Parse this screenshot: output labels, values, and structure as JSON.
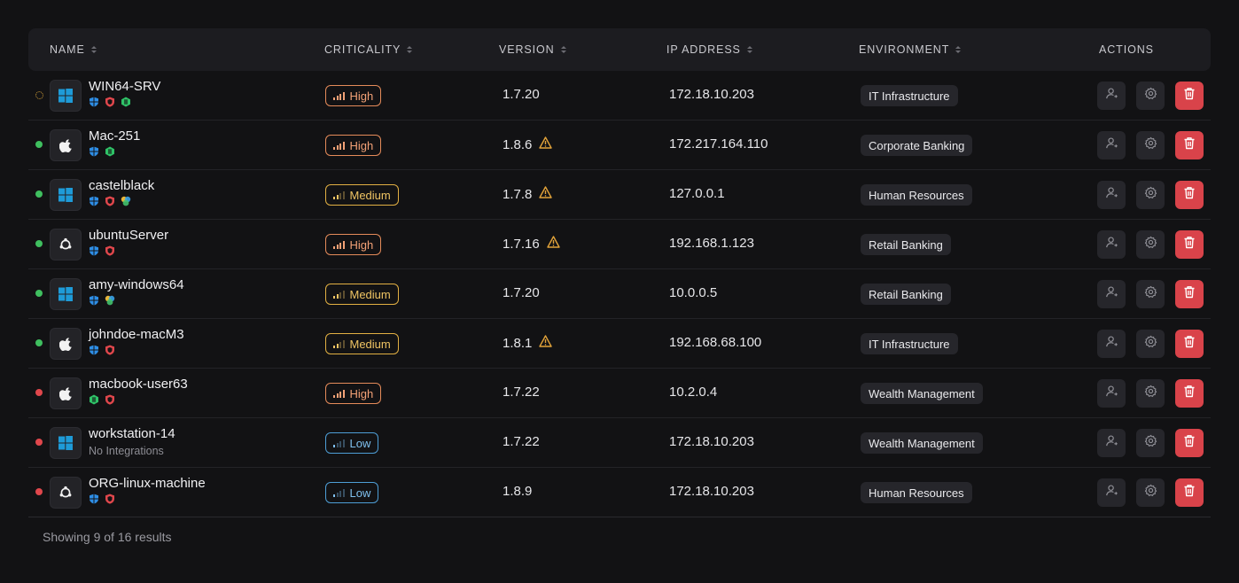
{
  "table": {
    "headers": {
      "name": "NAME",
      "criticality": "CRITICALITY",
      "version": "VERSION",
      "ip": "IP ADDRESS",
      "environment": "ENVIRONMENT",
      "actions": "ACTIONS"
    },
    "rows": [
      {
        "status": "loading",
        "os": "windows",
        "name": "WIN64-SRV",
        "integrations": [
          "defender-shield",
          "red-shield",
          "green-hexagon"
        ],
        "criticality": "High",
        "version": "1.7.20",
        "version_warning": false,
        "ip": "172.18.10.203",
        "environment": "IT Infrastructure"
      },
      {
        "status": "online",
        "os": "apple",
        "name": "Mac-251",
        "integrations": [
          "defender-shield",
          "green-hexagon"
        ],
        "criticality": "High",
        "version": "1.8.6",
        "version_warning": true,
        "ip": "172.217.164.110",
        "environment": "Corporate Banking"
      },
      {
        "status": "online",
        "os": "windows",
        "name": "castelblack",
        "integrations": [
          "defender-shield",
          "red-shield",
          "multicolor-globe"
        ],
        "criticality": "Medium",
        "version": "1.7.8",
        "version_warning": true,
        "ip": "127.0.0.1",
        "environment": "Human Resources"
      },
      {
        "status": "online",
        "os": "linux",
        "name": "ubuntuServer",
        "integrations": [
          "defender-shield",
          "red-shield"
        ],
        "criticality": "High",
        "version": "1.7.16",
        "version_warning": true,
        "ip": "192.168.1.123",
        "environment": "Retail Banking"
      },
      {
        "status": "online",
        "os": "windows",
        "name": "amy-windows64",
        "integrations": [
          "defender-shield",
          "multicolor-globe"
        ],
        "criticality": "Medium",
        "version": "1.7.20",
        "version_warning": false,
        "ip": "10.0.0.5",
        "environment": "Retail Banking"
      },
      {
        "status": "online",
        "os": "apple",
        "name": "johndoe-macM3",
        "integrations": [
          "defender-shield",
          "red-shield"
        ],
        "criticality": "Medium",
        "version": "1.8.1",
        "version_warning": true,
        "ip": "192.168.68.100",
        "environment": "IT Infrastructure"
      },
      {
        "status": "offline",
        "os": "apple",
        "name": "macbook-user63",
        "integrations": [
          "green-hexagon",
          "red-shield"
        ],
        "criticality": "High",
        "version": "1.7.22",
        "version_warning": false,
        "ip": "10.2.0.4",
        "environment": "Wealth Management"
      },
      {
        "status": "offline",
        "os": "windows",
        "name": "workstation-14",
        "integrations": [],
        "no_integrations_label": "No Integrations",
        "criticality": "Low",
        "version": "1.7.22",
        "version_warning": false,
        "ip": "172.18.10.203",
        "environment": "Wealth Management"
      },
      {
        "status": "offline",
        "os": "linux",
        "name": "ORG-linux-machine",
        "integrations": [
          "defender-shield",
          "red-shield"
        ],
        "criticality": "Low",
        "version": "1.8.9",
        "version_warning": false,
        "ip": "172.18.10.203",
        "environment": "Human Resources"
      }
    ]
  },
  "footer": {
    "results_text": "Showing 9 of 16 results"
  },
  "colors": {
    "background": "#121214",
    "header_bg": "#1c1c20",
    "high": "#e58b5a",
    "medium": "#e2b043",
    "low": "#4e9ed6",
    "online": "#3fbf5f",
    "offline": "#e0474c",
    "delete": "#d9434a",
    "warning": "#e2a33a"
  }
}
